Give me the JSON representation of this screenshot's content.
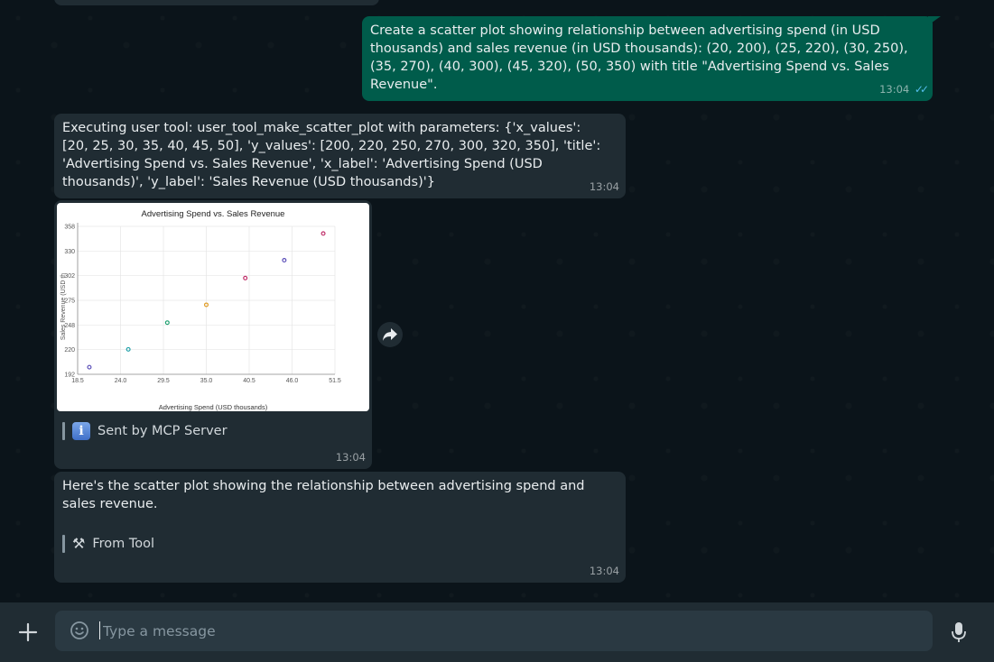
{
  "messages": {
    "user_request": {
      "text": "Create a scatter plot showing relationship between advertising spend (in USD thousands) and sales revenue (in USD thousands): (20, 200), (25, 220), (30, 250), (35, 270), (40, 300), (45, 320), (50, 350) with title \"Advertising Spend vs. Sales Revenue\".",
      "time": "13:04",
      "status": "read"
    },
    "tool_exec": {
      "text": "Executing user tool: user_tool_make_scatter_plot with parameters: {'x_values': [20, 25, 30, 35, 40, 45, 50], 'y_values': [200, 220, 250, 270, 300, 320, 350], 'title': 'Advertising Spend vs. Sales Revenue', 'x_label': 'Advertising Spend (USD thousands)', 'y_label': 'Sales Revenue (USD thousands)'}",
      "time": "13:04"
    },
    "chart_message": {
      "note": "Sent by MCP Server",
      "time": "13:04"
    },
    "reply": {
      "text": "Here's the scatter plot showing the relationship between advertising spend and sales revenue.",
      "note": "From Tool",
      "time": "13:04"
    }
  },
  "composer": {
    "placeholder": "Type a message"
  },
  "icons": {
    "ticks": "double-check-icon",
    "forward": "forward-icon",
    "plus": "plus-icon",
    "emoji": "emoji-icon",
    "mic": "mic-icon",
    "info": "info-icon",
    "tool": "tools-icon"
  },
  "colors": {
    "background": "#0b141a",
    "outgoing_bubble": "#005c4b",
    "incoming_bubble": "#202c33",
    "read_ticks": "#53bdeb"
  },
  "chart_data": {
    "type": "scatter",
    "title": "Advertising Spend vs. Sales Revenue",
    "xlabel": "Advertising Spend (USD thousands)",
    "ylabel": "Sales Revenue (USD th",
    "x": [
      20,
      25,
      30,
      35,
      40,
      45,
      50
    ],
    "y": [
      200,
      220,
      250,
      270,
      300,
      320,
      350
    ],
    "point_colors": [
      "#5b4fb8",
      "#1fa0a8",
      "#1fa070",
      "#e09a20",
      "#c0306a",
      "#5b4fb8",
      "#c0306a"
    ],
    "xlim": [
      18.5,
      51.5
    ],
    "ylim": [
      192,
      358
    ],
    "xticks": [
      "18.5",
      "24.0",
      "29.5",
      "35.0",
      "40.5",
      "46.0",
      "51.5"
    ],
    "yticks": [
      "192",
      "220",
      "248",
      "275",
      "302",
      "330",
      "358"
    ],
    "grid": true
  }
}
